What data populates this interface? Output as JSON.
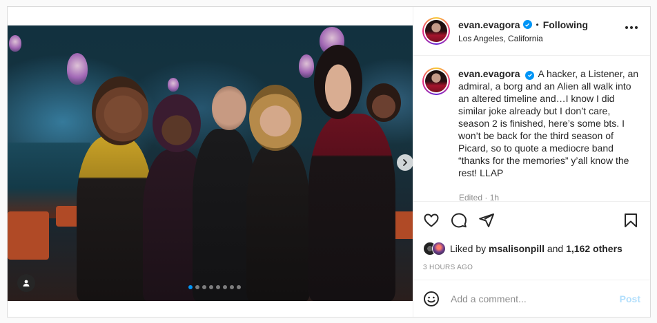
{
  "header": {
    "username": "evan.evagora",
    "separator": "•",
    "follow_state": "Following",
    "location": "Los Angeles, California"
  },
  "caption": {
    "username": "evan.evagora",
    "text": "A hacker, a Listener, an admiral, a borg and an Alien all walk into an altered timeline and…I know I did similar joke already but I don’t care, season 2 is finished, here’s some bts. I won’t be back for the third season of Picard, so to quote a mediocre band “thanks for the memories” y’all know the rest! LLAP",
    "edited": "Edited · 1h"
  },
  "likes": {
    "prefix": "Liked by",
    "user": "msalisonpill",
    "connector": "and",
    "others": "1,162 others"
  },
  "timestamp": "3 HOURS AGO",
  "comment": {
    "placeholder": "Add a comment...",
    "post_label": "Post"
  },
  "carousel": {
    "slide_count": 8,
    "active_index": 0
  },
  "colors": {
    "verified": "#0095f6",
    "post_disabled": "#b2dffc",
    "accent_blue": "#0095f6"
  },
  "icons": {
    "like": "heart-icon",
    "comment": "comment-icon",
    "share": "share-icon",
    "save": "bookmark-icon",
    "emoji": "emoji-icon",
    "more": "more-icon",
    "tag": "user-tag-icon",
    "next": "chevron-right-icon"
  }
}
